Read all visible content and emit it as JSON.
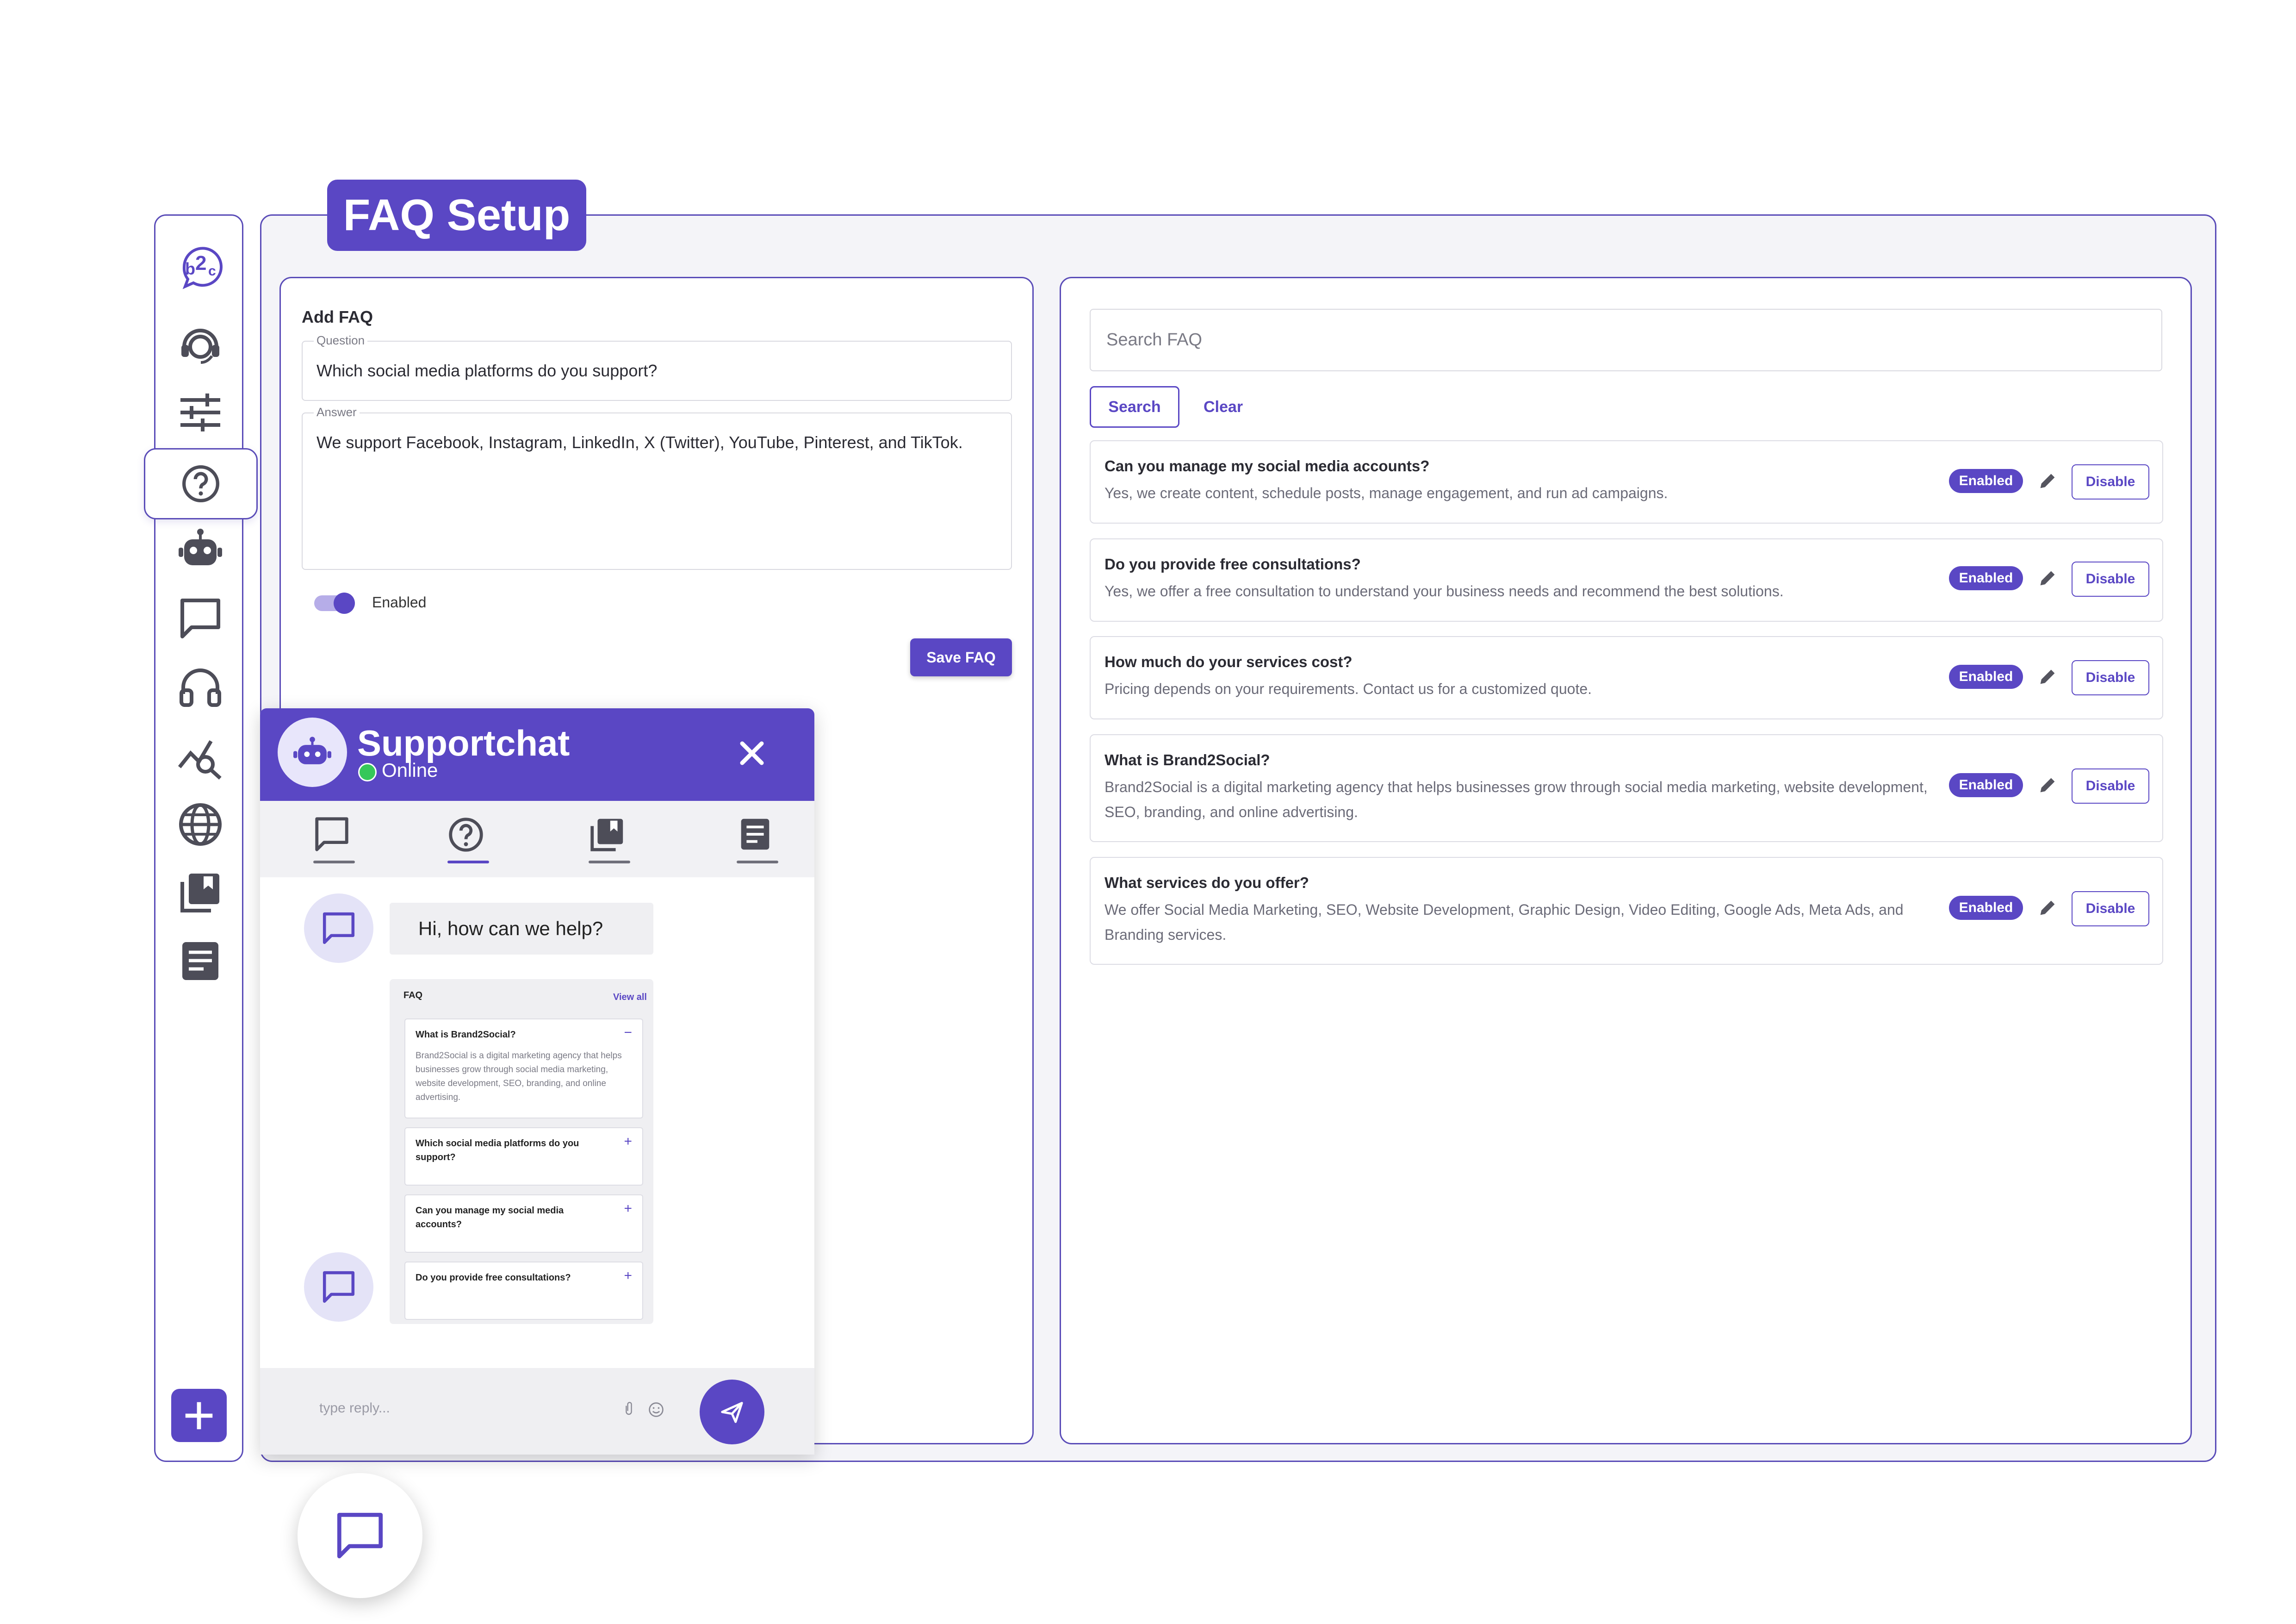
{
  "page": {
    "title": "FAQ Setup"
  },
  "sidebar": {
    "logo": "b2c",
    "items": [
      {
        "icon": "support-agent-icon"
      },
      {
        "icon": "sliders-icon"
      },
      {
        "icon": "help-circle-icon",
        "active": true
      },
      {
        "icon": "robot-icon"
      },
      {
        "icon": "chat-icon"
      },
      {
        "icon": "headphones-icon"
      },
      {
        "icon": "analytics-icon"
      },
      {
        "icon": "globe-icon"
      },
      {
        "icon": "library-icon"
      },
      {
        "icon": "document-icon"
      }
    ],
    "add_icon": "plus-icon"
  },
  "add_faq": {
    "heading": "Add FAQ",
    "question_label": "Question",
    "question_value": "Which social media platforms do you support?",
    "answer_label": "Answer",
    "answer_value": "We support Facebook, Instagram, LinkedIn, X (Twitter), YouTube, Pinterest, and TikTok.",
    "toggle_label": "Enabled",
    "toggle_on": true,
    "save_label": "Save FAQ"
  },
  "faq_list": {
    "search_placeholder": "Search FAQ",
    "search_label": "Search",
    "clear_label": "Clear",
    "items": [
      {
        "question": "Can you manage my social media accounts?",
        "answer": "Yes, we create content, schedule posts, manage engagement, and run ad campaigns.",
        "status": "Enabled",
        "action": "Disable"
      },
      {
        "question": "Do you provide free consultations?",
        "answer": "Yes, we offer a free consultation to understand your business needs and recommend the best solutions.",
        "status": "Enabled",
        "action": "Disable"
      },
      {
        "question": "How much do your services cost?",
        "answer": "Pricing depends on your requirements. Contact us for a customized quote.",
        "status": "Enabled",
        "action": "Disable"
      },
      {
        "question": "What is Brand2Social?",
        "answer": "Brand2Social is a digital marketing agency that helps businesses grow through social media marketing, website development, SEO, branding, and online advertising.",
        "status": "Enabled",
        "action": "Disable"
      },
      {
        "question": "What services do you offer?",
        "answer": "We offer Social Media Marketing, SEO, Website Development, Graphic Design, Video Editing, Google Ads, Meta Ads, and Branding services.",
        "status": "Enabled",
        "action": "Disable"
      }
    ]
  },
  "chat": {
    "title": "Supportchat",
    "status": "Online",
    "greeting": "Hi, how can we help?",
    "faq_card": {
      "title": "FAQ",
      "view_all": "View all",
      "items": [
        {
          "question": "What is Brand2Social?",
          "answer": "Brand2Social is a digital marketing agency that helps businesses grow through social media marketing, website development, SEO, branding, and online advertising.",
          "sign": "−"
        },
        {
          "question": "Which social media platforms do you support?",
          "sign": "+"
        },
        {
          "question": "Can you manage my social media accounts?",
          "sign": "+"
        },
        {
          "question": "Do you provide free consultations?",
          "sign": "+"
        }
      ]
    },
    "input_placeholder": "type reply..."
  },
  "colors": {
    "accent": "#5a47c4",
    "online": "#36c75a"
  }
}
